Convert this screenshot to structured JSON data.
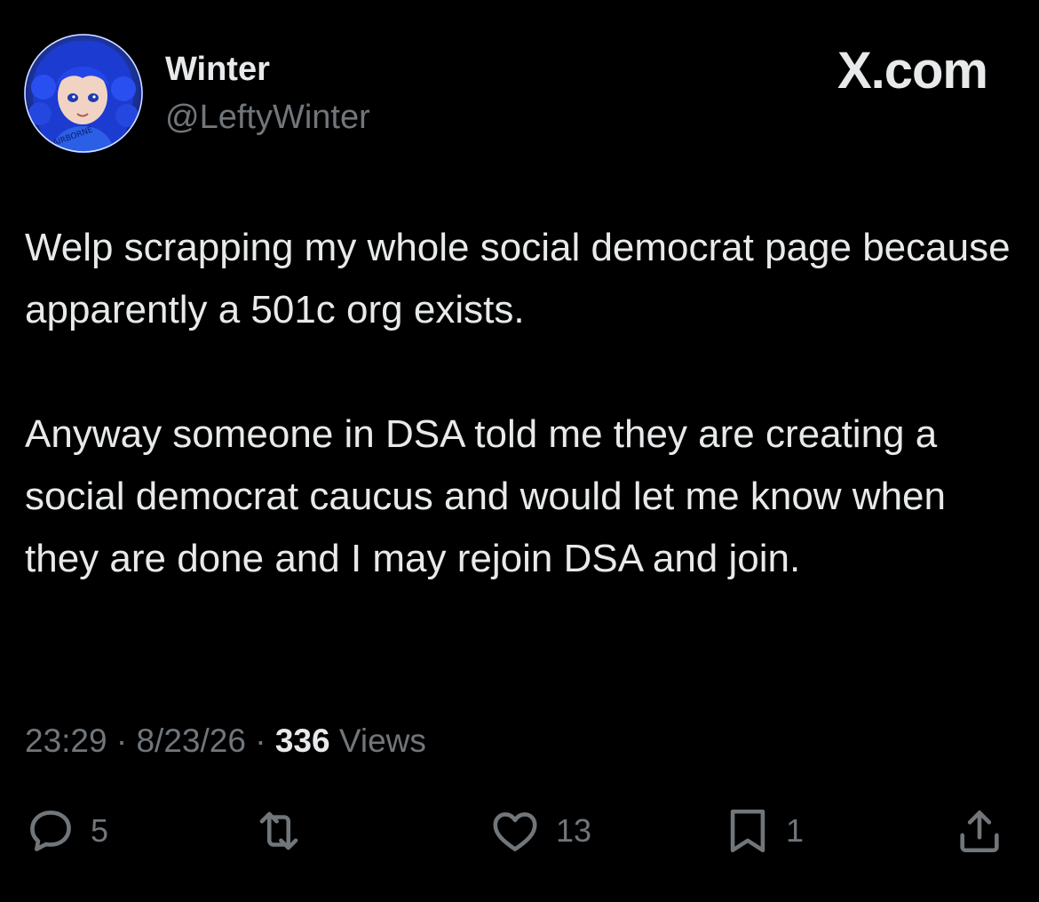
{
  "author": {
    "display_name": "Winter",
    "handle": "@LeftyWinter",
    "avatar_icon": "avatar-anime-girl-blue-hair"
  },
  "brand": {
    "label": "X.com"
  },
  "tweet": {
    "paragraphs": [
      "Welp scrapping my whole social democrat page because apparently a 501c org exists.",
      "Anyway someone in DSA told me they are creating a social democrat caucus and would let me know when they are done and I may rejoin DSA and join."
    ],
    "time": "23:29",
    "date": "8/23/26",
    "separator": "·",
    "views_count": "336",
    "views_label": "Views"
  },
  "actions": {
    "reply_count": "5",
    "retweet_count": "",
    "like_count": "13",
    "bookmark_count": "1"
  },
  "colors": {
    "background": "#000000",
    "text_primary": "#e7e9ea",
    "text_secondary": "#71767b"
  }
}
